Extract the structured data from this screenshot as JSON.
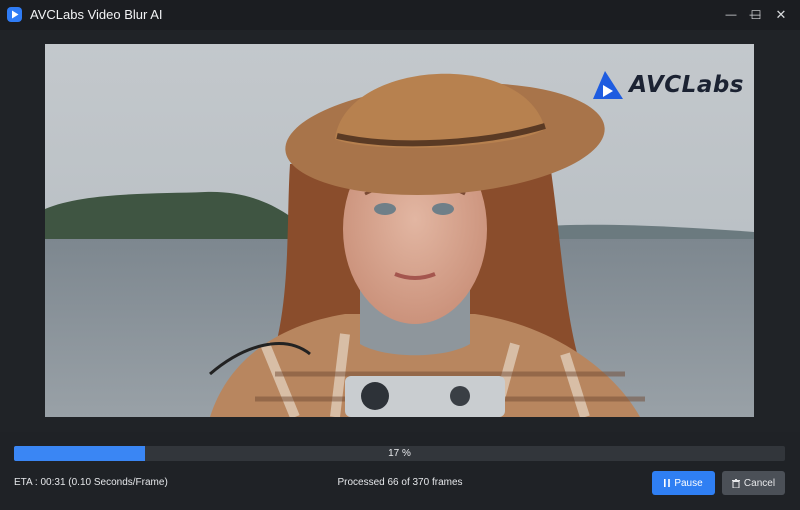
{
  "window": {
    "title": "AVCLabs Video Blur AI",
    "logo_icon": "play-logo-icon",
    "minimize_glyph": "—",
    "maximize_glyph": "☐",
    "close_glyph": "✕"
  },
  "preview": {
    "watermark_text": "AVCLabs",
    "watermark_icon": "avclabs-logo-icon"
  },
  "progress": {
    "percent": 17,
    "label": "17 %",
    "fill_color": "#3a86f4"
  },
  "status": {
    "eta": "ETA : 00:31 (0.10 Seconds/Frame)",
    "processed": "Processed 66 of 370 frames"
  },
  "buttons": {
    "pause_label": "Pause",
    "pause_icon": "pause-icon",
    "cancel_label": "Cancel",
    "cancel_icon": "trash-icon"
  },
  "colors": {
    "accent": "#2f7ff3",
    "background": "#1f2226",
    "cancel_bg": "#4b5057"
  }
}
